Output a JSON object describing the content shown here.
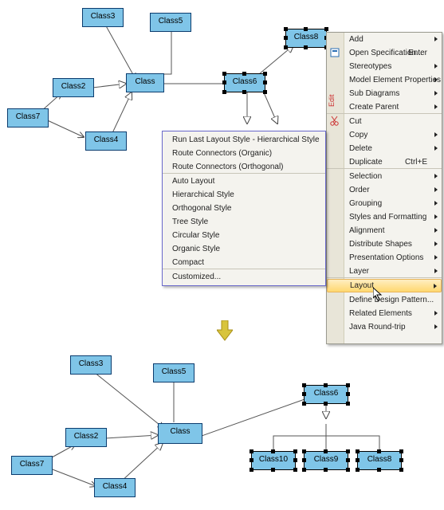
{
  "top": {
    "nodes": {
      "class3": "Class3",
      "class5": "Class5",
      "class8": "Class8",
      "class2": "Class2",
      "class": "Class",
      "class6": "Class6",
      "class7": "Class7",
      "class4": "Class4"
    }
  },
  "bottom": {
    "nodes": {
      "class3": "Class3",
      "class5": "Class5",
      "class6": "Class6",
      "class2": "Class2",
      "class": "Class",
      "class7": "Class7",
      "class4": "Class4",
      "class10": "Class10",
      "class9": "Class9",
      "class8": "Class8"
    }
  },
  "context": {
    "items": [
      {
        "label": "Add",
        "arrow": true
      },
      {
        "label": "Open Specification...",
        "shortcut": "Enter",
        "icon": "spec"
      },
      {
        "label": "Stereotypes",
        "arrow": true
      },
      {
        "label": "Model Element Properties",
        "arrow": true
      },
      {
        "label": "Sub Diagrams",
        "arrow": true
      },
      {
        "label": "Create Parent",
        "arrow": true,
        "sep": true
      },
      {
        "label": "Cut",
        "icon": "cut",
        "ext": "Edit"
      },
      {
        "label": "Copy",
        "arrow": true
      },
      {
        "label": "Delete",
        "arrow": true
      },
      {
        "label": "Duplicate",
        "shortcut": "Ctrl+E",
        "sep": true
      },
      {
        "label": "Selection",
        "arrow": true
      },
      {
        "label": "Order",
        "arrow": true
      },
      {
        "label": "Grouping",
        "arrow": true
      },
      {
        "label": "Styles and Formatting",
        "arrow": true
      },
      {
        "label": "Alignment",
        "arrow": true
      },
      {
        "label": "Distribute Shapes",
        "arrow": true
      },
      {
        "label": "Presentation Options",
        "arrow": true
      },
      {
        "label": "Layer",
        "arrow": true,
        "sep": true
      },
      {
        "label": "Layout",
        "arrow": true,
        "hl": true,
        "sep": true
      },
      {
        "label": "Define Design Pattern..."
      },
      {
        "label": "Related Elements",
        "arrow": true
      },
      {
        "label": "Java Round-trip",
        "arrow": true
      }
    ]
  },
  "submenu": {
    "items": [
      {
        "label": "Run Last Layout Style - Hierarchical Style"
      },
      {
        "label": "Route Connectors (Organic)"
      },
      {
        "label": "Route Connectors (Orthogonal)",
        "sep": true
      },
      {
        "label": "Auto Layout"
      },
      {
        "label": "Hierarchical Style"
      },
      {
        "label": "Orthogonal Style"
      },
      {
        "label": "Tree Style"
      },
      {
        "label": "Circular Style"
      },
      {
        "label": "Organic Style"
      },
      {
        "label": "Compact",
        "sep": true
      },
      {
        "label": "Customized..."
      }
    ]
  }
}
